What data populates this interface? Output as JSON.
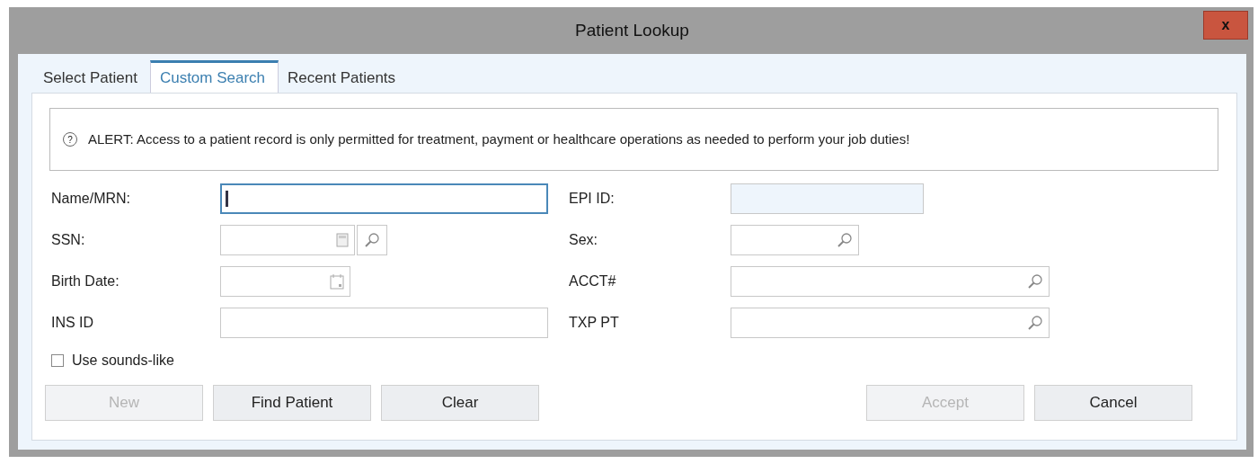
{
  "window": {
    "title": "Patient Lookup",
    "close": "x"
  },
  "tabs": [
    {
      "label": "Select Patient",
      "selected": false
    },
    {
      "label": "Custom Search",
      "selected": true
    },
    {
      "label": "Recent Patients",
      "selected": false
    }
  ],
  "alert": {
    "icon": "?",
    "text": "ALERT: Access to a patient record is only permitted for treatment, payment or healthcare operations as needed to perform your job duties!"
  },
  "fields": [
    {
      "label": "Name/MRN:",
      "kind": "text",
      "focused": true
    },
    {
      "label": "EPI ID:",
      "kind": "readonly",
      "focused": false
    },
    {
      "label": "SSN:",
      "kind": "ssn",
      "focused": false
    },
    {
      "label": "Sex:",
      "kind": "short-search",
      "focused": false
    },
    {
      "label": "Birth Date:",
      "kind": "date",
      "focused": false
    },
    {
      "label": "ACCT#",
      "kind": "search",
      "focused": false
    },
    {
      "label": "INS ID",
      "kind": "text",
      "focused": false
    },
    {
      "label": "TXP PT",
      "kind": "search",
      "focused": false
    }
  ],
  "sounds_like": {
    "label": "Use sounds-like",
    "checked": false
  },
  "left_buttons": [
    {
      "label": "New",
      "disabled": true
    },
    {
      "label": "Find Patient",
      "disabled": false
    },
    {
      "label": "Clear",
      "disabled": false
    }
  ],
  "right_buttons": [
    {
      "label": "Accept",
      "disabled": true
    },
    {
      "label": "Cancel",
      "disabled": false
    }
  ]
}
